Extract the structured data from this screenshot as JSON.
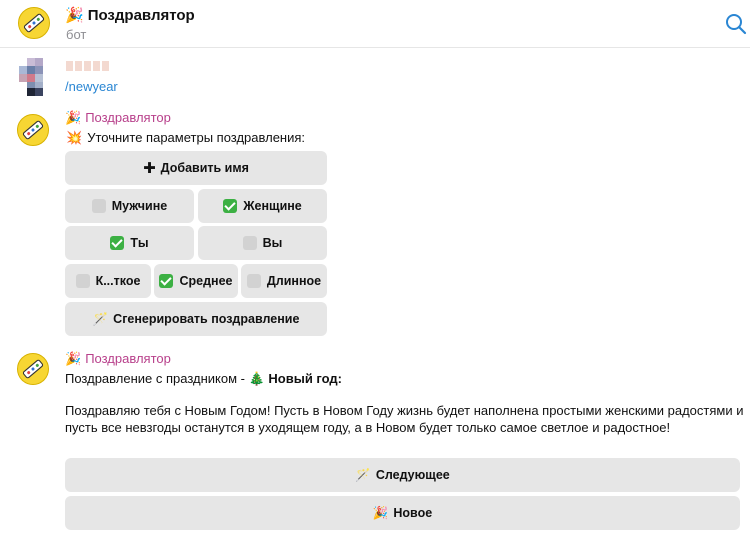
{
  "header": {
    "emoji": "🎉",
    "title": "Поздравлятор",
    "subtitle": "бот"
  },
  "user_message": {
    "command": "/newyear"
  },
  "bot_message_1": {
    "sender_emoji": "🎉",
    "sender": "Поздравлятор",
    "text_emoji": "💥",
    "text": "Уточните параметры поздравления:",
    "buttons": {
      "add_name": "Добавить имя",
      "men": "Мужчине",
      "women": "Женщине",
      "ty": "Ты",
      "vy": "Вы",
      "short": "К...ткое",
      "medium": "Среднее",
      "long": "Длинное",
      "generate": "Сгенерировать поздравление"
    },
    "selected": {
      "gender": "women",
      "form": "ty",
      "length": "medium"
    }
  },
  "bot_message_2": {
    "sender_emoji": "🎉",
    "sender": "Поздравлятор",
    "intro": "Поздравление с праздником - ",
    "holiday_emoji": "🎄",
    "holiday": "Новый год:",
    "body": "Поздравляю тебя с Новым Годом! Пусть в Новом Году жизнь будет наполнена простыми женскими радостями и пусть все невзгоды останутся в уходящем году, а в Новом будет только самое светлое и радостное!",
    "buttons": {
      "next_emoji": "🪄",
      "next": "Следующее",
      "new_emoji": "🎉",
      "new": "Новое"
    }
  },
  "colors": {
    "bot_name": "#b8408b",
    "link": "#2a86d3",
    "button_bg": "#e6e6e6",
    "avatar_yellow": "#f7d633"
  }
}
